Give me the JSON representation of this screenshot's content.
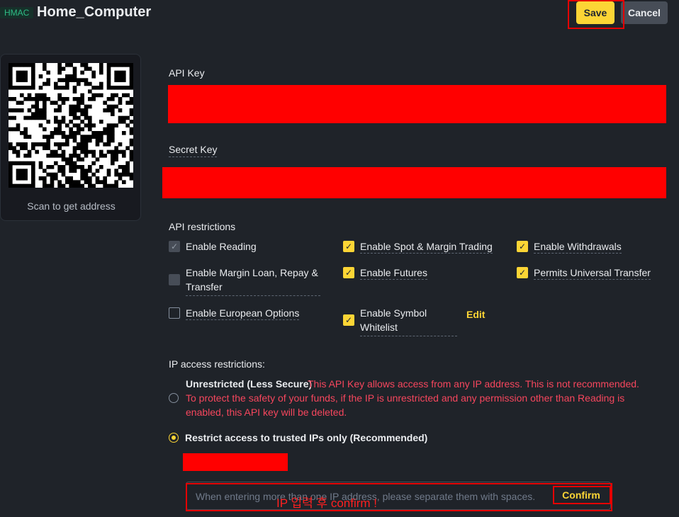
{
  "header": {
    "tag": "HMAC",
    "title": "Home_Computer",
    "save_label": "Save",
    "cancel_label": "Cancel"
  },
  "qr": {
    "caption": "Scan to get address"
  },
  "api_key": {
    "label": "API Key"
  },
  "secret_key": {
    "label": "Secret Key"
  },
  "restrictions": {
    "heading": "API restrictions",
    "options": [
      {
        "label": "Enable Reading",
        "checked": true,
        "disabled": true
      },
      {
        "label": "Enable Spot & Margin Trading",
        "checked": true
      },
      {
        "label": "Enable Withdrawals",
        "checked": true
      },
      {
        "label": "Enable Margin Loan, Repay &",
        "label2": "Transfer",
        "checked": false,
        "disabled": true
      },
      {
        "label": "Enable Futures",
        "checked": true
      },
      {
        "label": "Permits Universal Transfer",
        "checked": true
      },
      {
        "label": "Enable European Options",
        "checked": false
      },
      {
        "label": "Enable Symbol",
        "label2": "Whitelist",
        "checked": true
      }
    ],
    "edit_label": "Edit"
  },
  "ip": {
    "heading": "IP access restrictions:",
    "unrestricted_label": "Unrestricted (Less Secure)",
    "unrestricted_warn1": "This API Key allows access from any IP address. This is not recommended.",
    "unrestricted_warn2": "To protect the safety of your funds, if the IP is unrestricted and any permission other than Reading is",
    "unrestricted_warn3": "enabled, this API key will be deleted.",
    "restrict_label": "Restrict access to trusted IPs only (Recommended)",
    "input_placeholder": "When entering more than one IP address, please separate them with spaces.",
    "confirm_label": "Confirm",
    "annotation": "IP 입력 후 confirm !"
  },
  "colors": {
    "accent": "#fcd535",
    "background": "#1f2329",
    "warning": "#f6465d",
    "redaction": "#ff0000"
  }
}
